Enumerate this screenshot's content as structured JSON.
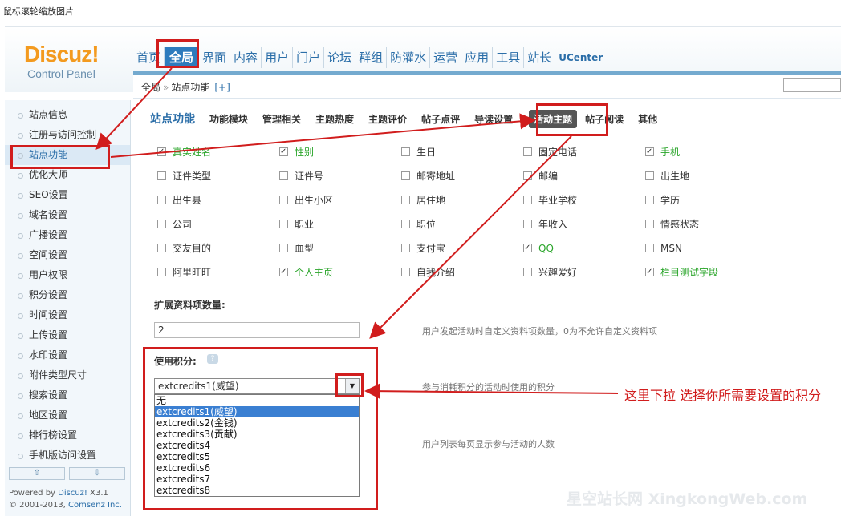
{
  "window_title": "鼠标滚轮缩放图片",
  "logo": {
    "main": "Discuz!",
    "sub": "Control Panel"
  },
  "topnav": [
    "首页",
    "全局",
    "界面",
    "内容",
    "用户",
    "门户",
    "论坛",
    "群组",
    "防灌水",
    "运营",
    "应用",
    "工具",
    "站长",
    "UCenter"
  ],
  "topnav_active": 1,
  "breadcrumb": {
    "root": "全局",
    "sep": "»",
    "current": "站点功能",
    "plus": "[+]"
  },
  "sidebar": [
    "站点信息",
    "注册与访问控制",
    "站点功能",
    "优化大师",
    "SEO设置",
    "域名设置",
    "广播设置",
    "空间设置",
    "用户权限",
    "积分设置",
    "时间设置",
    "上传设置",
    "水印设置",
    "附件类型尺寸",
    "搜索设置",
    "地区设置",
    "排行榜设置",
    "手机版访问设置"
  ],
  "sidebar_active": 2,
  "scroll_up": "⇧",
  "scroll_down": "⇩",
  "powered": {
    "prefix": "Powered by ",
    "brand": "Discuz!",
    "version": " X3.1",
    "copy": "© 2001-2013, ",
    "company": "Comsenz Inc."
  },
  "subnav": {
    "title": "站点功能",
    "items": [
      "功能模块",
      "管理相关",
      "主题热度",
      "主题评价",
      "帖子点评",
      "导读设置",
      "活动主题",
      "帖子阅读",
      "其他"
    ],
    "active": 6
  },
  "fields": [
    {
      "label": "真实姓名",
      "checked": true,
      "green": true
    },
    {
      "label": "性别",
      "checked": true,
      "green": true
    },
    {
      "label": "生日",
      "checked": false,
      "green": false
    },
    {
      "label": "固定电话",
      "checked": false,
      "green": false
    },
    {
      "label": "手机",
      "checked": true,
      "green": true
    },
    {
      "label": "证件类型",
      "checked": false,
      "green": false
    },
    {
      "label": "证件号",
      "checked": false,
      "green": false
    },
    {
      "label": "邮寄地址",
      "checked": false,
      "green": false
    },
    {
      "label": "邮编",
      "checked": false,
      "green": false
    },
    {
      "label": "出生地",
      "checked": false,
      "green": false
    },
    {
      "label": "出生县",
      "checked": false,
      "green": false
    },
    {
      "label": "出生小区",
      "checked": false,
      "green": false
    },
    {
      "label": "居住地",
      "checked": false,
      "green": false
    },
    {
      "label": "毕业学校",
      "checked": false,
      "green": false
    },
    {
      "label": "学历",
      "checked": false,
      "green": false
    },
    {
      "label": "公司",
      "checked": false,
      "green": false
    },
    {
      "label": "职业",
      "checked": false,
      "green": false
    },
    {
      "label": "职位",
      "checked": false,
      "green": false
    },
    {
      "label": "年收入",
      "checked": false,
      "green": false
    },
    {
      "label": "情感状态",
      "checked": false,
      "green": false
    },
    {
      "label": "交友目的",
      "checked": false,
      "green": false
    },
    {
      "label": "血型",
      "checked": false,
      "green": false
    },
    {
      "label": "支付宝",
      "checked": false,
      "green": false
    },
    {
      "label": "QQ",
      "checked": true,
      "green": true
    },
    {
      "label": "MSN",
      "checked": false,
      "green": false
    },
    {
      "label": "阿里旺旺",
      "checked": false,
      "green": false
    },
    {
      "label": "个人主页",
      "checked": true,
      "green": true
    },
    {
      "label": "自我介绍",
      "checked": false,
      "green": false
    },
    {
      "label": "兴趣爱好",
      "checked": false,
      "green": false
    },
    {
      "label": "栏目测试字段",
      "checked": true,
      "green": true
    }
  ],
  "ext_count": {
    "label": "扩展资料项数量:",
    "value": "2",
    "desc": "用户发起活动时自定义资料项数量，0为不允许自定义资料项"
  },
  "credit": {
    "label": "使用积分:",
    "help": "?",
    "selected": "extcredits1(威望)",
    "arrow": "▼",
    "desc": "参与消耗积分的活动时使用的积分",
    "options": [
      "无",
      "extcredits1(威望)",
      "extcredits2(金钱)",
      "extcredits3(贡献)",
      "extcredits4",
      "extcredits5",
      "extcredits6",
      "extcredits7",
      "extcredits8"
    ],
    "selected_index": 1
  },
  "list_desc": "用户列表每页显示参与活动的人数",
  "annotation": "这里下拉 选择你所需要设置的积分",
  "watermark": "星空站长网 XingkongWeb.com",
  "colors": {
    "accent": "#2d7bbd",
    "annotation_red": "#d11d1d",
    "checked_green": "#2aa52a"
  }
}
